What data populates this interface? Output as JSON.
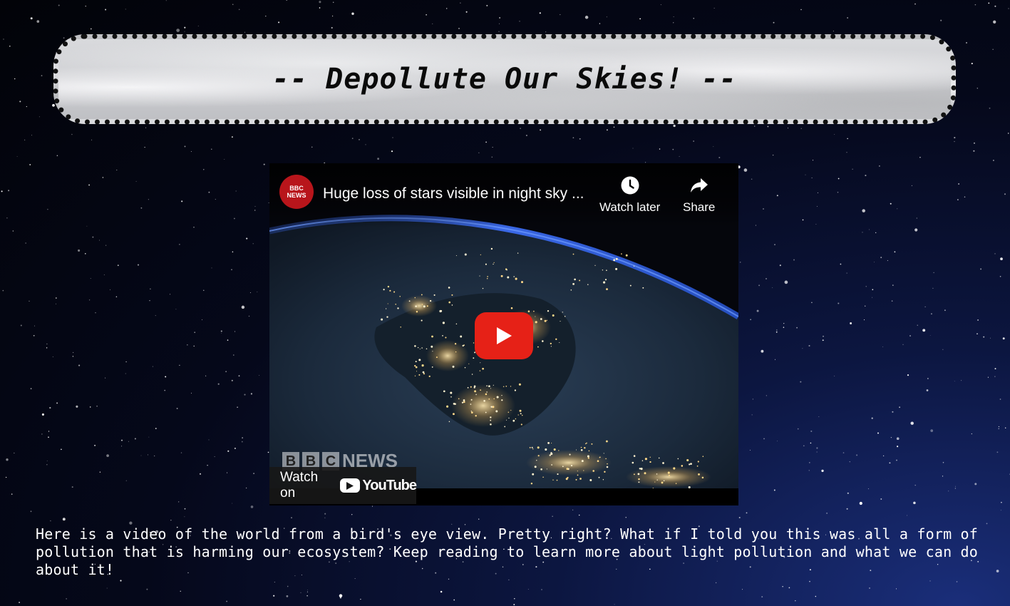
{
  "page": {
    "title": "-- Depollute Our Skies! --"
  },
  "video": {
    "channel": {
      "name_line1": "BBC",
      "name_line2": "NEWS"
    },
    "title": "Huge loss of stars visible in night sky ...",
    "actions": {
      "watch_later": "Watch later",
      "share": "Share"
    },
    "watermark": {
      "letters": [
        "B",
        "B",
        "C"
      ],
      "word": "NEWS"
    },
    "watch_on": {
      "label": "Watch on",
      "brand": "YouTube"
    }
  },
  "intro": {
    "text": "Here is a video of the world from a bird's eye view. Pretty right? What if I told you this was all a form of pollution that is harming our ecosystem? Keep reading to learn more about light pollution and what we can do about it!"
  },
  "colors": {
    "play_button": "#e62117",
    "channel_avatar": "#b8151b",
    "text": "#ffffff"
  }
}
